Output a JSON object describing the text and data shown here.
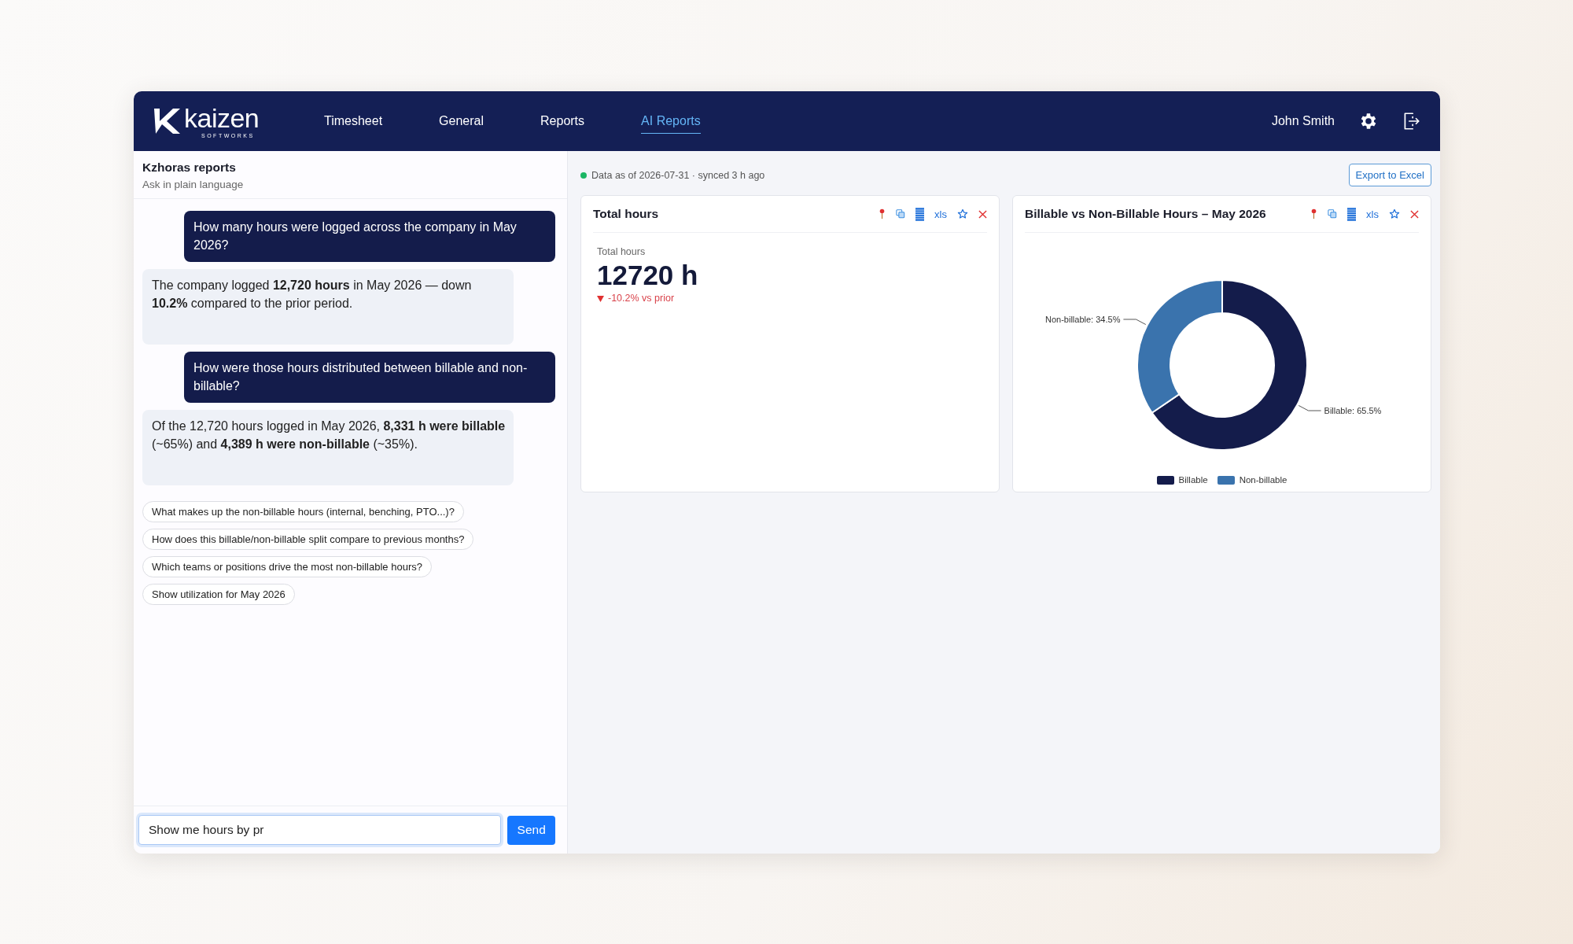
{
  "header": {
    "logo": {
      "name": "kaizen",
      "tagline": "SOFTWORKS"
    },
    "nav": [
      {
        "label": "Timesheet",
        "selected": false
      },
      {
        "label": "General",
        "selected": false
      },
      {
        "label": "Reports",
        "selected": false
      },
      {
        "label": "AI Reports",
        "selected": true
      }
    ],
    "user": "John Smith"
  },
  "chat": {
    "title": "Kzhoras reports",
    "subtitle": "Ask in plain language",
    "messages": [
      {
        "kind": "user",
        "text": "How many hours were logged across the company in May 2026?"
      },
      {
        "kind": "assistant",
        "text": "The company logged **12,720 hours** in May 2026 — down **10.2%** compared to the prior period."
      },
      {
        "kind": "user",
        "text": "How were those hours distributed between billable and non-billable?"
      },
      {
        "kind": "assistant",
        "text": "Of the 12,720 hours logged in May 2026, **8,331 h were billable** (~65%) and **4,389 h were non-billable** (~35%)."
      }
    ],
    "suggestions": [
      "What makes up the non-billable hours (internal, benching, PTO...)?",
      "How does this billable/non-billable split compare to previous months?",
      "Which teams or positions drive the most non-billable hours?",
      "Show utilization for May 2026"
    ],
    "input": {
      "value": "Show me hours by pr"
    },
    "send_label": "Send"
  },
  "dashboard": {
    "status": "Data as of 2026-07-31 · synced 3 h ago",
    "export_button": "Export to Excel",
    "cards": [
      {
        "kind": "metric",
        "title": "Total hours",
        "export_label": "xls",
        "metric": {
          "label": "Total hours",
          "value": "12720 h",
          "falling": true,
          "change": "-10.2% vs prior"
        }
      },
      {
        "kind": "chart",
        "title": "Billable vs Non-Billable Hours – May 2026",
        "export_label": "xls",
        "chart_data": {
          "type": "donut",
          "categories": [
            "Billable",
            "Non-billable"
          ],
          "values": [
            65.5,
            34.5
          ],
          "value_labels": [
            "Billable: 65.5%",
            "Non-billable: 34.5%"
          ],
          "legend": "bottom"
        }
      }
    ]
  }
}
